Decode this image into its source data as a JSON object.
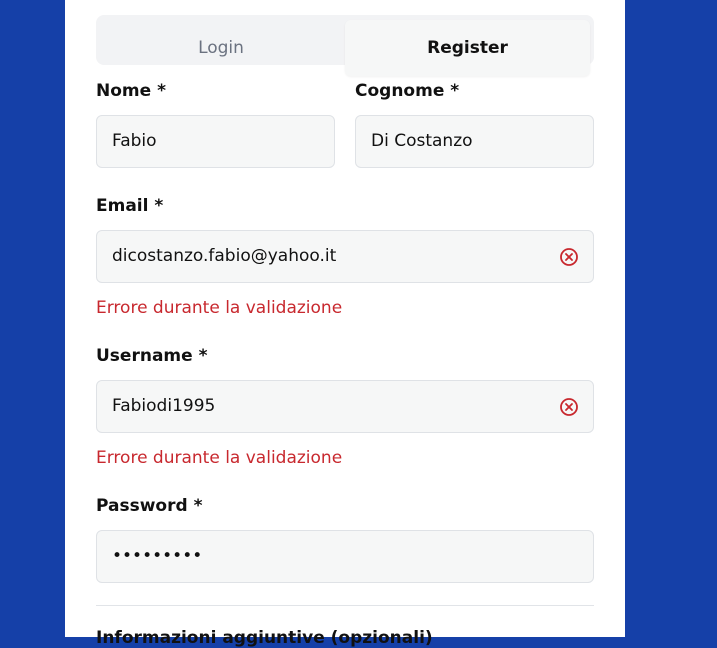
{
  "tabs": {
    "login": "Login",
    "register": "Register"
  },
  "form": {
    "first_name": {
      "label": "Nome *",
      "value": "Fabio"
    },
    "last_name": {
      "label": "Cognome *",
      "value": "Di Costanzo"
    },
    "email": {
      "label": "Email *",
      "value": "dicostanzo.fabio@yahoo.it",
      "error": "Errore durante la validazione"
    },
    "username": {
      "label": "Username *",
      "value": "Fabiodi1995",
      "error": "Errore durante la validazione"
    },
    "password": {
      "label": "Password *",
      "value": "•••••••••"
    },
    "next_section": "Informazioni aggiuntive (opzionali)"
  },
  "colors": {
    "background": "#1540a8",
    "error": "#c8282e"
  }
}
